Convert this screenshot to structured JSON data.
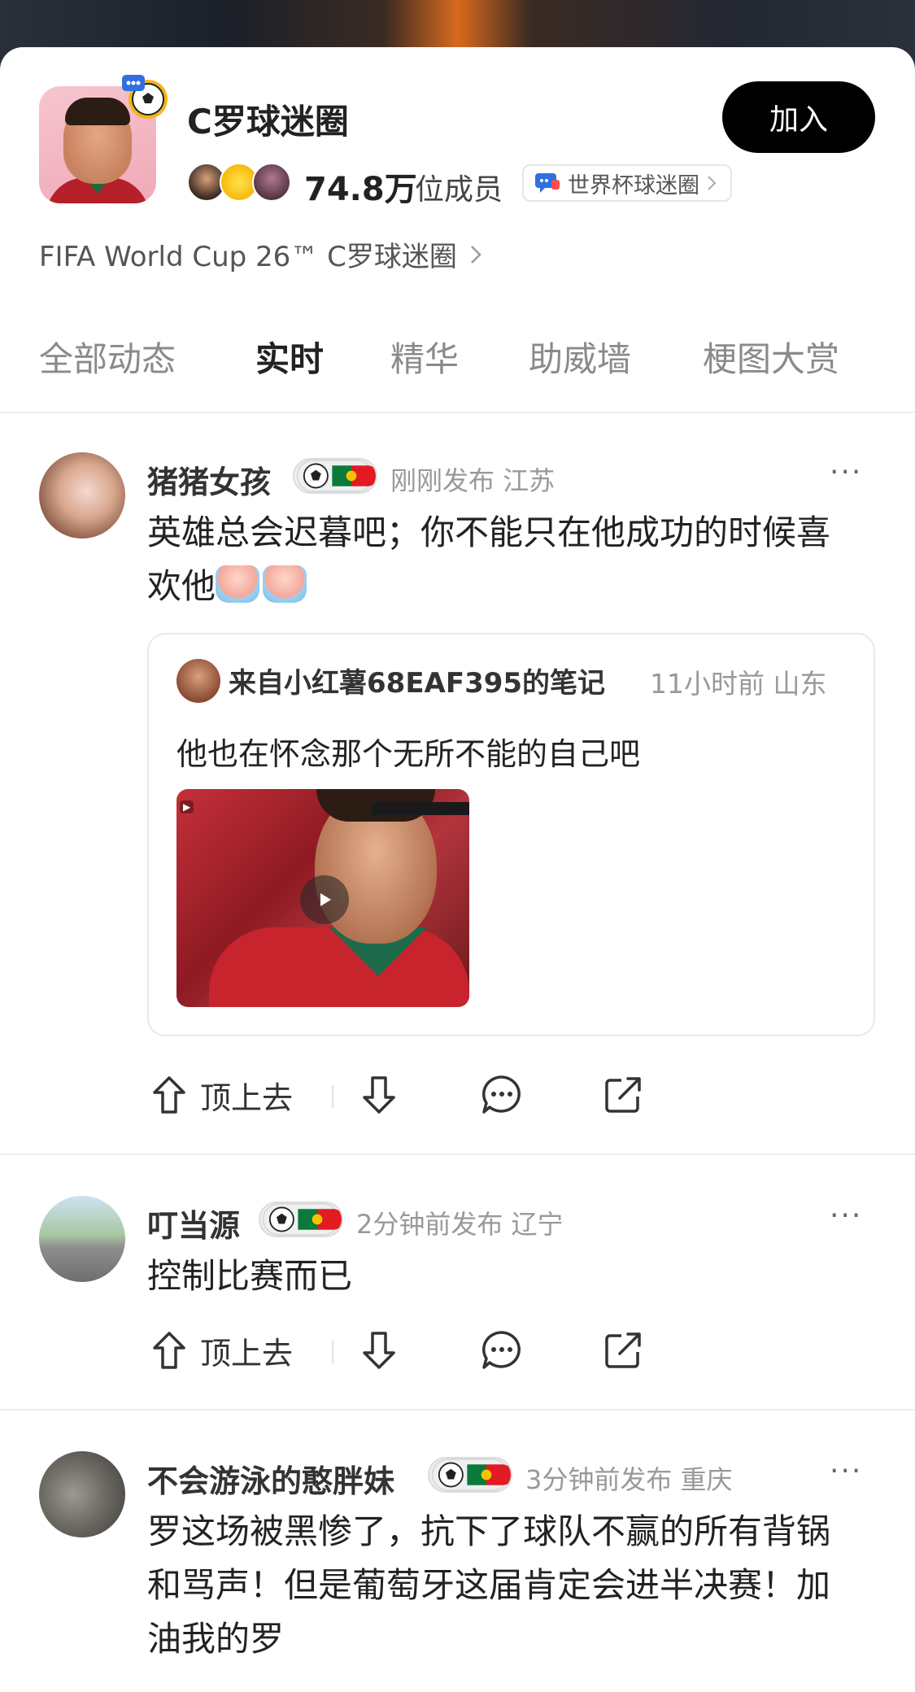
{
  "circle": {
    "name": "C罗球迷圈",
    "member_count": "74.8万",
    "member_suffix": "位成员",
    "chip_label": "世界杯球迷圈",
    "join_label": "加入",
    "subtitle": "FIFA World Cup 26™ C罗球迷圈"
  },
  "tabs": [
    {
      "label": "全部动态",
      "active": false
    },
    {
      "label": "实时",
      "active": true
    },
    {
      "label": "精华",
      "active": false
    },
    {
      "label": "助威墙",
      "active": false
    },
    {
      "label": "梗图大赏",
      "active": false
    }
  ],
  "posts": [
    {
      "author": "猪猪女孩",
      "meta": "刚刚发布 江苏",
      "text_line1": "英雄总会迟暮吧；你不能只在他成功的时候喜",
      "text_line2": "欢他",
      "quote": {
        "source": "来自小红薯68EAF395的笔记",
        "meta": "11小时前 山东",
        "text": "他也在怀念那个无所不能的自己吧"
      }
    },
    {
      "author": "叮当源",
      "meta": "2分钟前发布 辽宁",
      "text_line1": "控制比赛而已"
    },
    {
      "author": "不会游泳的憨胖妹",
      "meta": "3分钟前发布 重庆",
      "text_line1": "罗这场被黑惨了，抗下了球队不赢的所有背锅",
      "text_line2": "和骂声！但是葡萄牙这届肯定会进半决赛！加",
      "text_line3": "油我的罗"
    }
  ],
  "actions": {
    "upvote_label": "顶上去"
  }
}
